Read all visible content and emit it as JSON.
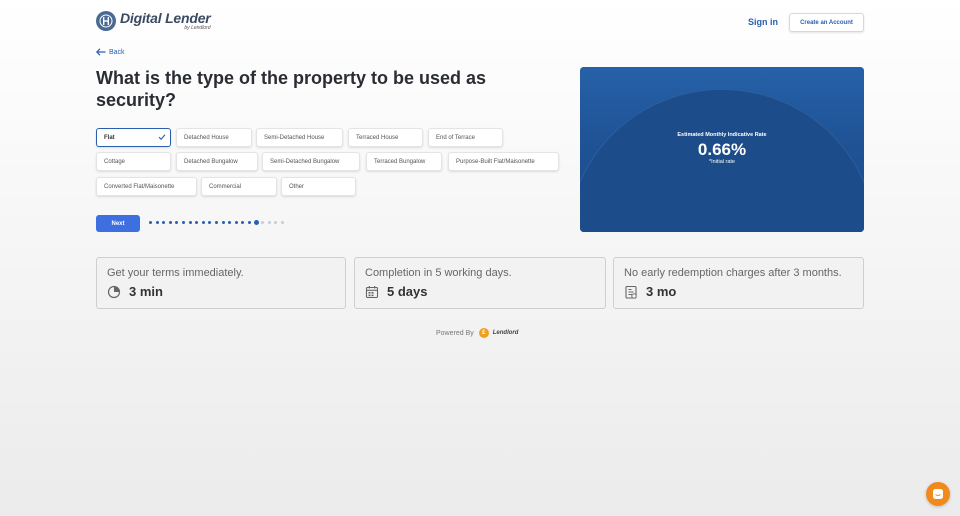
{
  "header": {
    "brand_title": "Digital Lender",
    "brand_sub": "by Lendlord",
    "signin_label": "Sign in",
    "create_account_label": "Create an Account"
  },
  "back_label": "Back",
  "question": "What is the type of the property to be used as security?",
  "options": [
    {
      "label": "Flat",
      "selected": true
    },
    {
      "label": "Detached House"
    },
    {
      "label": "Semi-Detached House"
    },
    {
      "label": "Terraced House"
    },
    {
      "label": "End of Terrace"
    },
    {
      "label": "Cottage"
    },
    {
      "label": "Detached Bungalow"
    },
    {
      "label": "Semi-Detached Bungalow"
    },
    {
      "label": "Terraced Bungalow"
    },
    {
      "label": "Purpose-Built Flat/Maisonette"
    },
    {
      "label": "Converted Flat/Maisonette"
    },
    {
      "label": "Commercial"
    },
    {
      "label": "Other"
    }
  ],
  "next_label": "Next",
  "progress": {
    "steps": 21,
    "current": 17
  },
  "rate_panel": {
    "label": "Estimated Monthly Indicative Rate",
    "value": "0.66%",
    "note": "*Initial rate"
  },
  "cards": [
    {
      "title": "Get your terms immediately.",
      "value": "3 min",
      "icon": "clock-icon"
    },
    {
      "title": "Completion in 5 working days.",
      "value": "5 days",
      "icon": "calendar-icon"
    },
    {
      "title": "No early redemption charges after 3 months.",
      "value": "3 mo",
      "icon": "document-icon"
    }
  ],
  "powered_by": {
    "label": "Powered By",
    "brand": "Lendlord",
    "logo_glyph": "£"
  },
  "colors": {
    "accent": "#3d6fe0",
    "link": "#2a5fb0",
    "panel": "#1e4f8f",
    "chat": "#f08a1c"
  }
}
